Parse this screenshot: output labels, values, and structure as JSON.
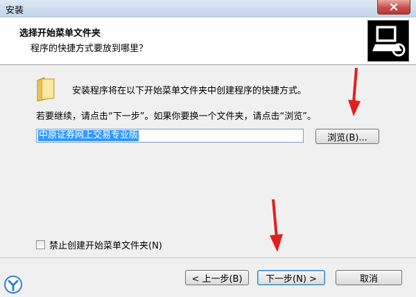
{
  "window": {
    "title": "安装"
  },
  "header": {
    "title": "选择开始菜单文件夹",
    "subtitle": "程序的快捷方式要放到哪里？"
  },
  "body": {
    "intro": "安装程序将在以下开始菜单文件夹中创建程序的快捷方式。",
    "instruction": "若要继续，请点击“下一步”。如果你要换一个文件夹，请点击“浏览”。",
    "folder_value": "中原证券网上交易专业版",
    "browse_label": "浏览(B)...",
    "checkbox_label": "禁止创建开始菜单文件夹(N)",
    "checkbox_checked": false
  },
  "footer": {
    "back_label": "< 上一步(B)",
    "next_label": "下一步(N) >",
    "cancel_label": "取消"
  },
  "colors": {
    "selection": "#3399ff",
    "annotation_arrow": "#e02020"
  },
  "icons": [
    "close-icon",
    "folder-icon",
    "setup-computer-icon",
    "arrow-annotation",
    "watermark-logo-icon"
  ]
}
